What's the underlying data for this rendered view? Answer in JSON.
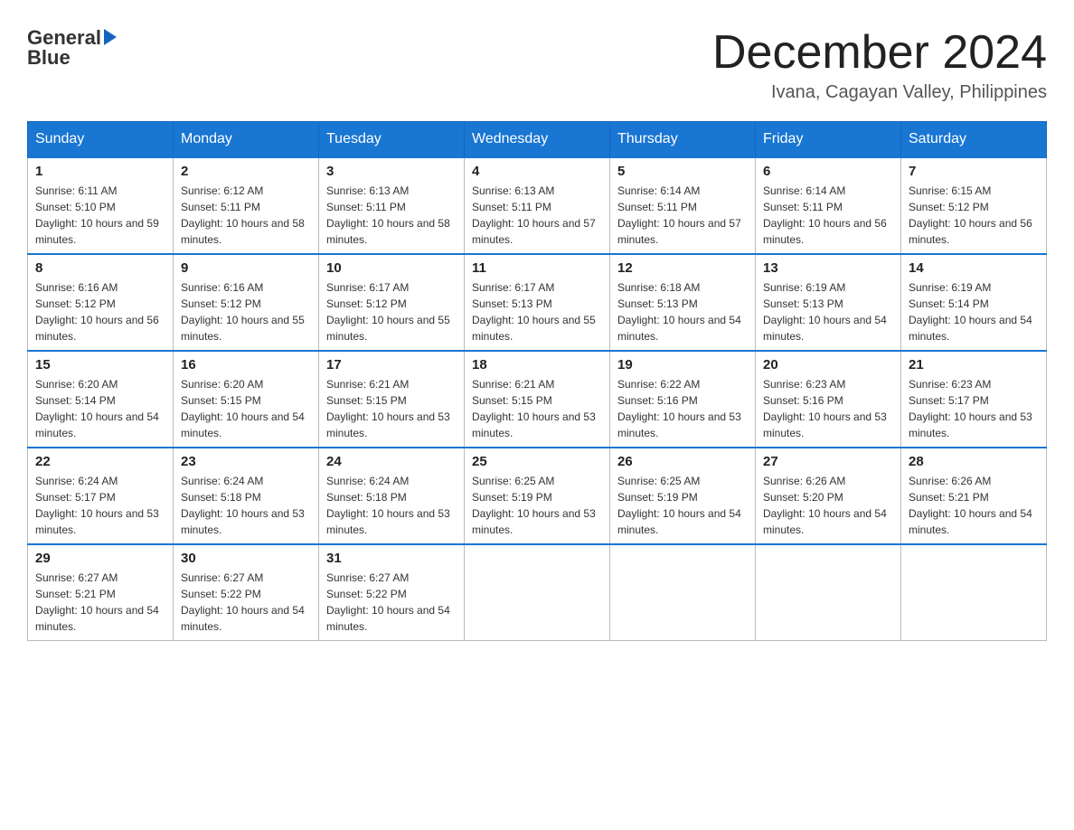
{
  "logo": {
    "text_general": "General",
    "text_blue": "Blue",
    "arrow": "▶"
  },
  "header": {
    "title": "December 2024",
    "subtitle": "Ivana, Cagayan Valley, Philippines"
  },
  "columns": [
    "Sunday",
    "Monday",
    "Tuesday",
    "Wednesday",
    "Thursday",
    "Friday",
    "Saturday"
  ],
  "weeks": [
    [
      {
        "day": "1",
        "sunrise": "6:11 AM",
        "sunset": "5:10 PM",
        "daylight": "10 hours and 59 minutes."
      },
      {
        "day": "2",
        "sunrise": "6:12 AM",
        "sunset": "5:11 PM",
        "daylight": "10 hours and 58 minutes."
      },
      {
        "day": "3",
        "sunrise": "6:13 AM",
        "sunset": "5:11 PM",
        "daylight": "10 hours and 58 minutes."
      },
      {
        "day": "4",
        "sunrise": "6:13 AM",
        "sunset": "5:11 PM",
        "daylight": "10 hours and 57 minutes."
      },
      {
        "day": "5",
        "sunrise": "6:14 AM",
        "sunset": "5:11 PM",
        "daylight": "10 hours and 57 minutes."
      },
      {
        "day": "6",
        "sunrise": "6:14 AM",
        "sunset": "5:11 PM",
        "daylight": "10 hours and 56 minutes."
      },
      {
        "day": "7",
        "sunrise": "6:15 AM",
        "sunset": "5:12 PM",
        "daylight": "10 hours and 56 minutes."
      }
    ],
    [
      {
        "day": "8",
        "sunrise": "6:16 AM",
        "sunset": "5:12 PM",
        "daylight": "10 hours and 56 minutes."
      },
      {
        "day": "9",
        "sunrise": "6:16 AM",
        "sunset": "5:12 PM",
        "daylight": "10 hours and 55 minutes."
      },
      {
        "day": "10",
        "sunrise": "6:17 AM",
        "sunset": "5:12 PM",
        "daylight": "10 hours and 55 minutes."
      },
      {
        "day": "11",
        "sunrise": "6:17 AM",
        "sunset": "5:13 PM",
        "daylight": "10 hours and 55 minutes."
      },
      {
        "day": "12",
        "sunrise": "6:18 AM",
        "sunset": "5:13 PM",
        "daylight": "10 hours and 54 minutes."
      },
      {
        "day": "13",
        "sunrise": "6:19 AM",
        "sunset": "5:13 PM",
        "daylight": "10 hours and 54 minutes."
      },
      {
        "day": "14",
        "sunrise": "6:19 AM",
        "sunset": "5:14 PM",
        "daylight": "10 hours and 54 minutes."
      }
    ],
    [
      {
        "day": "15",
        "sunrise": "6:20 AM",
        "sunset": "5:14 PM",
        "daylight": "10 hours and 54 minutes."
      },
      {
        "day": "16",
        "sunrise": "6:20 AM",
        "sunset": "5:15 PM",
        "daylight": "10 hours and 54 minutes."
      },
      {
        "day": "17",
        "sunrise": "6:21 AM",
        "sunset": "5:15 PM",
        "daylight": "10 hours and 53 minutes."
      },
      {
        "day": "18",
        "sunrise": "6:21 AM",
        "sunset": "5:15 PM",
        "daylight": "10 hours and 53 minutes."
      },
      {
        "day": "19",
        "sunrise": "6:22 AM",
        "sunset": "5:16 PM",
        "daylight": "10 hours and 53 minutes."
      },
      {
        "day": "20",
        "sunrise": "6:23 AM",
        "sunset": "5:16 PM",
        "daylight": "10 hours and 53 minutes."
      },
      {
        "day": "21",
        "sunrise": "6:23 AM",
        "sunset": "5:17 PM",
        "daylight": "10 hours and 53 minutes."
      }
    ],
    [
      {
        "day": "22",
        "sunrise": "6:24 AM",
        "sunset": "5:17 PM",
        "daylight": "10 hours and 53 minutes."
      },
      {
        "day": "23",
        "sunrise": "6:24 AM",
        "sunset": "5:18 PM",
        "daylight": "10 hours and 53 minutes."
      },
      {
        "day": "24",
        "sunrise": "6:24 AM",
        "sunset": "5:18 PM",
        "daylight": "10 hours and 53 minutes."
      },
      {
        "day": "25",
        "sunrise": "6:25 AM",
        "sunset": "5:19 PM",
        "daylight": "10 hours and 53 minutes."
      },
      {
        "day": "26",
        "sunrise": "6:25 AM",
        "sunset": "5:19 PM",
        "daylight": "10 hours and 54 minutes."
      },
      {
        "day": "27",
        "sunrise": "6:26 AM",
        "sunset": "5:20 PM",
        "daylight": "10 hours and 54 minutes."
      },
      {
        "day": "28",
        "sunrise": "6:26 AM",
        "sunset": "5:21 PM",
        "daylight": "10 hours and 54 minutes."
      }
    ],
    [
      {
        "day": "29",
        "sunrise": "6:27 AM",
        "sunset": "5:21 PM",
        "daylight": "10 hours and 54 minutes."
      },
      {
        "day": "30",
        "sunrise": "6:27 AM",
        "sunset": "5:22 PM",
        "daylight": "10 hours and 54 minutes."
      },
      {
        "day": "31",
        "sunrise": "6:27 AM",
        "sunset": "5:22 PM",
        "daylight": "10 hours and 54 minutes."
      },
      null,
      null,
      null,
      null
    ]
  ]
}
